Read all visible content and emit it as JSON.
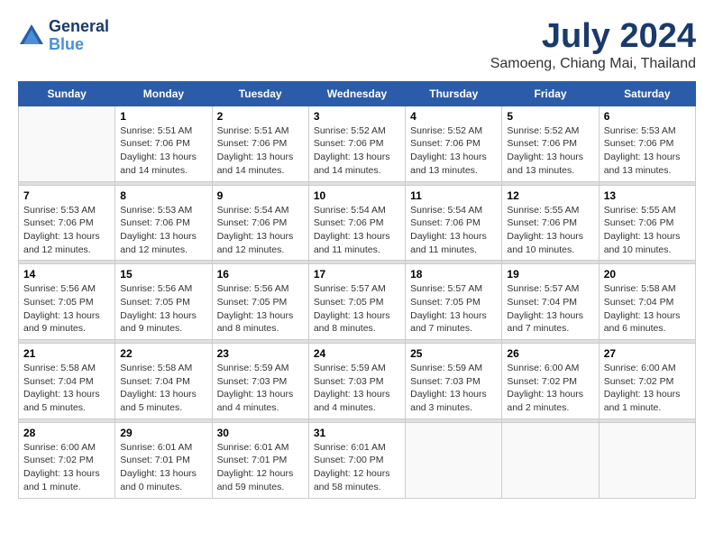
{
  "logo": {
    "line1": "General",
    "line2": "Blue"
  },
  "title": "July 2024",
  "location": "Samoeng, Chiang Mai, Thailand",
  "days_of_week": [
    "Sunday",
    "Monday",
    "Tuesday",
    "Wednesday",
    "Thursday",
    "Friday",
    "Saturday"
  ],
  "weeks": [
    [
      {
        "day": "",
        "info": ""
      },
      {
        "day": "1",
        "info": "Sunrise: 5:51 AM\nSunset: 7:06 PM\nDaylight: 13 hours\nand 14 minutes."
      },
      {
        "day": "2",
        "info": "Sunrise: 5:51 AM\nSunset: 7:06 PM\nDaylight: 13 hours\nand 14 minutes."
      },
      {
        "day": "3",
        "info": "Sunrise: 5:52 AM\nSunset: 7:06 PM\nDaylight: 13 hours\nand 14 minutes."
      },
      {
        "day": "4",
        "info": "Sunrise: 5:52 AM\nSunset: 7:06 PM\nDaylight: 13 hours\nand 13 minutes."
      },
      {
        "day": "5",
        "info": "Sunrise: 5:52 AM\nSunset: 7:06 PM\nDaylight: 13 hours\nand 13 minutes."
      },
      {
        "day": "6",
        "info": "Sunrise: 5:53 AM\nSunset: 7:06 PM\nDaylight: 13 hours\nand 13 minutes."
      }
    ],
    [
      {
        "day": "7",
        "info": "Sunrise: 5:53 AM\nSunset: 7:06 PM\nDaylight: 13 hours\nand 12 minutes."
      },
      {
        "day": "8",
        "info": "Sunrise: 5:53 AM\nSunset: 7:06 PM\nDaylight: 13 hours\nand 12 minutes."
      },
      {
        "day": "9",
        "info": "Sunrise: 5:54 AM\nSunset: 7:06 PM\nDaylight: 13 hours\nand 12 minutes."
      },
      {
        "day": "10",
        "info": "Sunrise: 5:54 AM\nSunset: 7:06 PM\nDaylight: 13 hours\nand 11 minutes."
      },
      {
        "day": "11",
        "info": "Sunrise: 5:54 AM\nSunset: 7:06 PM\nDaylight: 13 hours\nand 11 minutes."
      },
      {
        "day": "12",
        "info": "Sunrise: 5:55 AM\nSunset: 7:06 PM\nDaylight: 13 hours\nand 10 minutes."
      },
      {
        "day": "13",
        "info": "Sunrise: 5:55 AM\nSunset: 7:06 PM\nDaylight: 13 hours\nand 10 minutes."
      }
    ],
    [
      {
        "day": "14",
        "info": "Sunrise: 5:56 AM\nSunset: 7:05 PM\nDaylight: 13 hours\nand 9 minutes."
      },
      {
        "day": "15",
        "info": "Sunrise: 5:56 AM\nSunset: 7:05 PM\nDaylight: 13 hours\nand 9 minutes."
      },
      {
        "day": "16",
        "info": "Sunrise: 5:56 AM\nSunset: 7:05 PM\nDaylight: 13 hours\nand 8 minutes."
      },
      {
        "day": "17",
        "info": "Sunrise: 5:57 AM\nSunset: 7:05 PM\nDaylight: 13 hours\nand 8 minutes."
      },
      {
        "day": "18",
        "info": "Sunrise: 5:57 AM\nSunset: 7:05 PM\nDaylight: 13 hours\nand 7 minutes."
      },
      {
        "day": "19",
        "info": "Sunrise: 5:57 AM\nSunset: 7:04 PM\nDaylight: 13 hours\nand 7 minutes."
      },
      {
        "day": "20",
        "info": "Sunrise: 5:58 AM\nSunset: 7:04 PM\nDaylight: 13 hours\nand 6 minutes."
      }
    ],
    [
      {
        "day": "21",
        "info": "Sunrise: 5:58 AM\nSunset: 7:04 PM\nDaylight: 13 hours\nand 5 minutes."
      },
      {
        "day": "22",
        "info": "Sunrise: 5:58 AM\nSunset: 7:04 PM\nDaylight: 13 hours\nand 5 minutes."
      },
      {
        "day": "23",
        "info": "Sunrise: 5:59 AM\nSunset: 7:03 PM\nDaylight: 13 hours\nand 4 minutes."
      },
      {
        "day": "24",
        "info": "Sunrise: 5:59 AM\nSunset: 7:03 PM\nDaylight: 13 hours\nand 4 minutes."
      },
      {
        "day": "25",
        "info": "Sunrise: 5:59 AM\nSunset: 7:03 PM\nDaylight: 13 hours\nand 3 minutes."
      },
      {
        "day": "26",
        "info": "Sunrise: 6:00 AM\nSunset: 7:02 PM\nDaylight: 13 hours\nand 2 minutes."
      },
      {
        "day": "27",
        "info": "Sunrise: 6:00 AM\nSunset: 7:02 PM\nDaylight: 13 hours\nand 1 minute."
      }
    ],
    [
      {
        "day": "28",
        "info": "Sunrise: 6:00 AM\nSunset: 7:02 PM\nDaylight: 13 hours\nand 1 minute."
      },
      {
        "day": "29",
        "info": "Sunrise: 6:01 AM\nSunset: 7:01 PM\nDaylight: 13 hours\nand 0 minutes."
      },
      {
        "day": "30",
        "info": "Sunrise: 6:01 AM\nSunset: 7:01 PM\nDaylight: 12 hours\nand 59 minutes."
      },
      {
        "day": "31",
        "info": "Sunrise: 6:01 AM\nSunset: 7:00 PM\nDaylight: 12 hours\nand 58 minutes."
      },
      {
        "day": "",
        "info": ""
      },
      {
        "day": "",
        "info": ""
      },
      {
        "day": "",
        "info": ""
      }
    ]
  ]
}
